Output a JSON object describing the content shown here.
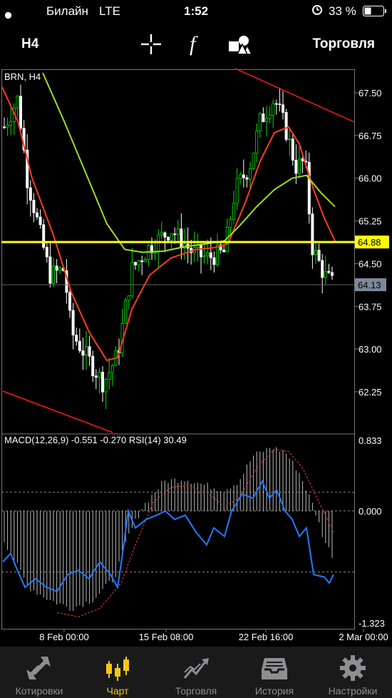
{
  "status": {
    "carrier": "Билайн",
    "network": "LTE",
    "time": "1:52",
    "battery": "33 %"
  },
  "toolbar": {
    "timeframe": "H4",
    "trading_label": "Торговля"
  },
  "chart": {
    "symbol_label": "BRN, H4",
    "price_ticks": [
      "67.50",
      "66.75",
      "66.00",
      "65.25",
      "64.50",
      "63.75",
      "63.00",
      "62.25"
    ],
    "horizontal_line_price": "64.88",
    "current_price": "64.13",
    "indicator_label": "MACD(12,26,9) -0.551 -0.270 RSI(14) 30.49",
    "macd_ticks": [
      "0.833",
      "0.000",
      "-1.323"
    ],
    "time_labels": [
      "8 Feb 00:00",
      "15 Feb 08:00",
      "22 Feb 16:00",
      "2 Mar 00:00"
    ],
    "colors": {
      "bull": "#00e000",
      "bear": "#ffffff",
      "ma_fast": "#ff3b1f",
      "ma_slow": "#9be01a",
      "hline": "#ffff00",
      "trendline": "#ff1a1a",
      "macd_signal": "#c0392b",
      "rsi": "#1e7cff"
    }
  },
  "tabbar": {
    "items": [
      {
        "label": "Котировки",
        "icon": "quotes-arrows-icon"
      },
      {
        "label": "Чарт",
        "icon": "candles-icon"
      },
      {
        "label": "Торговля",
        "icon": "trade-chart-icon"
      },
      {
        "label": "История",
        "icon": "history-tray-icon"
      },
      {
        "label": "Настройки",
        "icon": "gear-icon"
      }
    ],
    "active_index": 1
  }
}
